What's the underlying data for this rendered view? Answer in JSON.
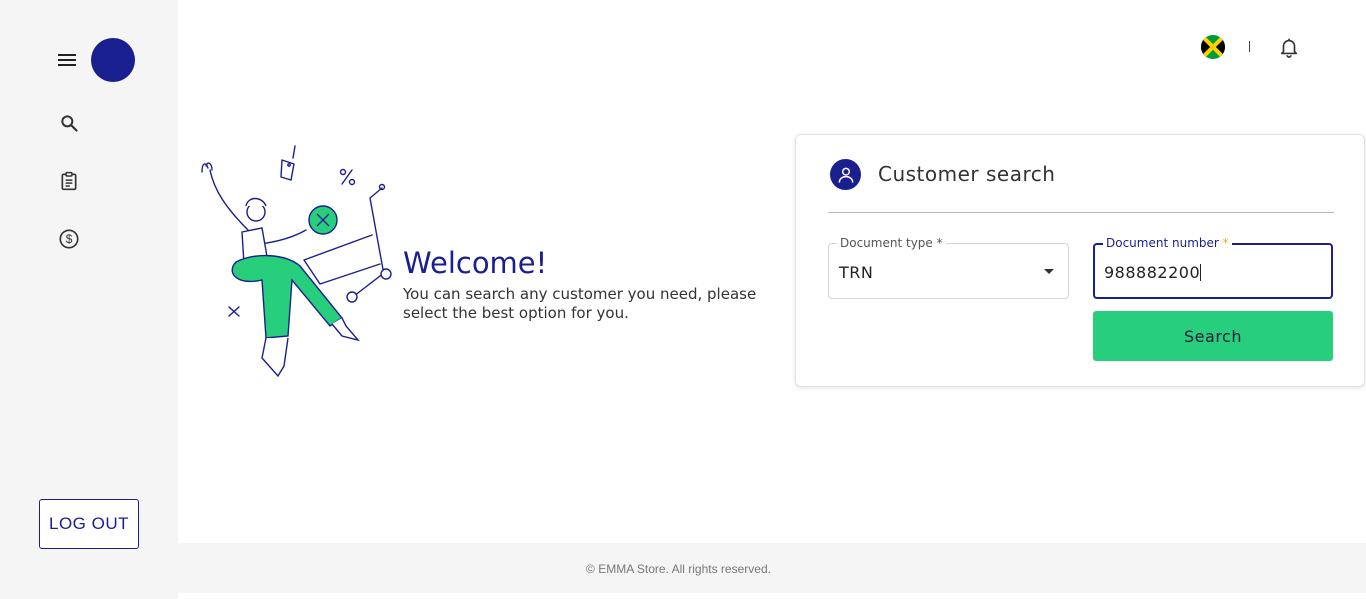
{
  "sidebar": {
    "menu_icon": "hamburger-menu-icon",
    "avatar_color": "#1a1f8f",
    "items": [
      {
        "icon": "search-icon"
      },
      {
        "icon": "clipboard-icon"
      },
      {
        "icon": "dollar-icon"
      }
    ],
    "logout_label": "LOG OUT"
  },
  "header": {
    "flag_icon": "jamaica-flag-icon",
    "separator": "|",
    "notification_icon": "bell-icon"
  },
  "welcome": {
    "title": "Welcome!",
    "text": "You can search any customer you need, please select the best option for you."
  },
  "search_card": {
    "icon": "user-icon",
    "title": "Customer search",
    "document_type": {
      "label": "Document type *",
      "value": "TRN"
    },
    "document_number": {
      "label": "Document number",
      "required_mark": "*",
      "value": "988882200"
    },
    "button_label": "Search"
  },
  "footer": {
    "text": "© EMMA Store. All rights reserved."
  },
  "colors": {
    "primary": "#1a1f8f",
    "accent": "#27cf7c",
    "sidebar_bg": "#f5f5f5"
  }
}
